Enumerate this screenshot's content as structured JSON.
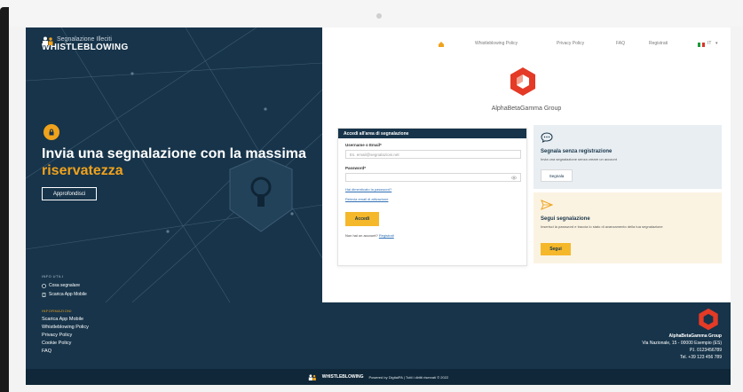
{
  "brand": {
    "subtitle": "Segnalazione Illeciti",
    "name": "WHISTLEBLOWING"
  },
  "hero": {
    "title_part1": "Invia una segnalazione con la massima ",
    "title_accent": "riservatezza",
    "cta_label": "Approfondisci",
    "info_heading": "INFO UTILI",
    "links": [
      "Cosa segnalare",
      "Scarica App Mobile"
    ]
  },
  "nav": {
    "items": [
      "Whistleblowing Policy",
      "Privacy Policy",
      "FAQ",
      "Registrati"
    ],
    "language": "IT"
  },
  "company": {
    "name": "AlphaBetaGamma Group"
  },
  "login": {
    "header": "Accedi all'area di segnalazione",
    "username_label": "Username o Email*",
    "username_placeholder": "Es. email@segnalazioni.net",
    "password_label": "Password*",
    "forgot_password": "Hai dimenticato la password?",
    "resend_activation": "Reinvia email di attivazione",
    "submit_label": "Accedi",
    "no_account_text": "Non hai un account?",
    "register_link": "Registrati"
  },
  "card_anonymous": {
    "title": "Segnala senza registrazione",
    "text": "Invia una segnalazione senza creare un account",
    "button": "Segnala"
  },
  "card_follow": {
    "title": "Segui segnalazione",
    "text": "Inserisci la password e traccia lo stato di avanzamento della tua segnalazione",
    "button": "Segui"
  },
  "footer": {
    "heading": "INFORMAZIONI",
    "links": [
      "Scarica App Mobile",
      "Whistleblowing Policy",
      "Privacy Policy",
      "Cookie Policy",
      "FAQ"
    ],
    "company_name": "AlphaBetaGamma Group",
    "address": "Via Nazionale, 15 - 00000 Esempio (ES)",
    "vat": "P.I. 0123456789",
    "phone": "Tel. +39 123 456 789",
    "bottom_brand": "WHISTLEBLOWING",
    "bottom_text": "Powered by DigitalPA | Tutti i diritti riservati © 2022"
  },
  "colors": {
    "navy": "#17344a",
    "accent": "#f0a21c",
    "button_yellow": "#f5b82a",
    "logo_red": "#e43a26"
  }
}
